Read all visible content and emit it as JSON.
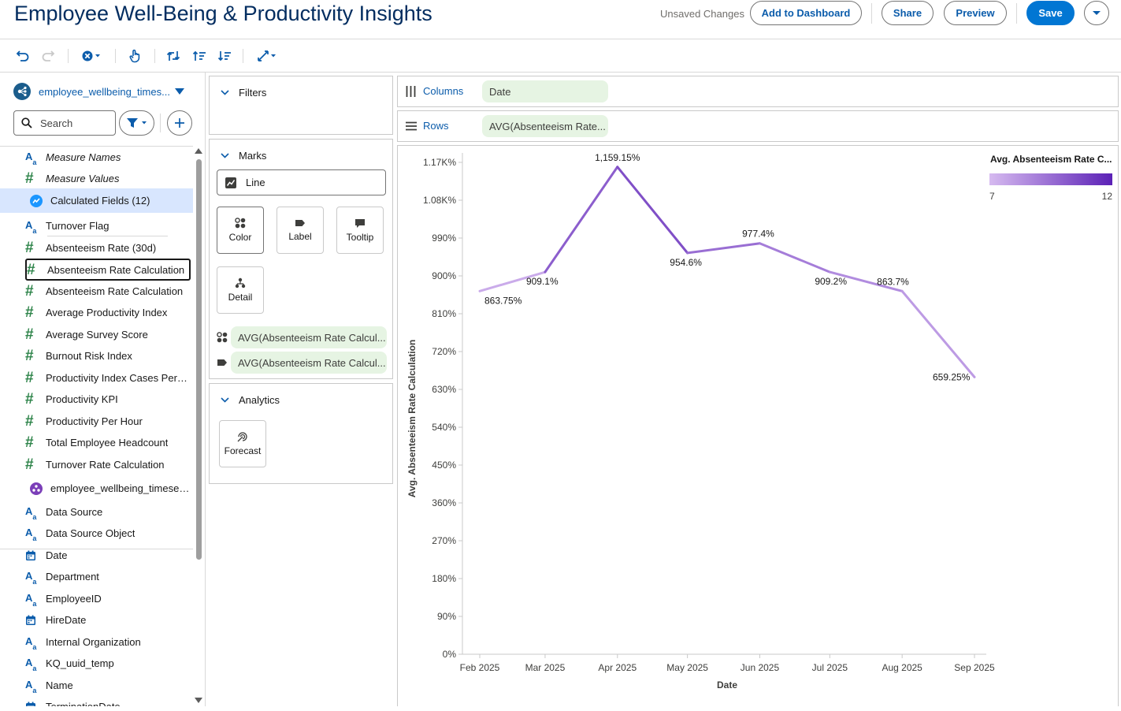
{
  "header": {
    "title": "Employee Well-Being & Productivity Insights",
    "status": "Unsaved Changes",
    "buttons": {
      "add_to_dashboard": "Add to Dashboard",
      "share": "Share",
      "preview": "Preview",
      "save": "Save"
    }
  },
  "toolbar": {
    "icons": [
      "undo-icon",
      "redo-icon",
      "clear-icon",
      "touch-icon",
      "swap-icon",
      "sort-ascending-icon",
      "sort-descending-icon",
      "fit-icon"
    ]
  },
  "data_panel": {
    "datasource": "employee_wellbeing_times...",
    "search_placeholder": "Search",
    "fields": [
      {
        "label": "Measure Names",
        "type": "text",
        "italic": true
      },
      {
        "label": "Measure Values",
        "type": "number",
        "italic": true
      },
      {
        "label": "Calculated Fields (12)",
        "type": "folder",
        "selected": true
      },
      {
        "label": "Turnover Flag",
        "type": "text"
      },
      {
        "label": "Absenteeism Rate (30d)",
        "type": "number"
      },
      {
        "label": "Absenteeism Rate Calculation",
        "type": "number",
        "outlined": true
      },
      {
        "label": "Absenteeism Rate Calculation",
        "type": "number"
      },
      {
        "label": "Average Productivity Index",
        "type": "number"
      },
      {
        "label": "Average Survey Score",
        "type": "number"
      },
      {
        "label": "Burnout Risk Index",
        "type": "number"
      },
      {
        "label": "Productivity Index Cases Per ...",
        "type": "number"
      },
      {
        "label": "Productivity KPI",
        "type": "number"
      },
      {
        "label": "Productivity Per Hour",
        "type": "number"
      },
      {
        "label": "Total Employee Headcount",
        "type": "number"
      },
      {
        "label": "Turnover Rate Calculation",
        "type": "number"
      },
      {
        "label": "employee_wellbeing_timeseri...",
        "type": "object"
      },
      {
        "label": "Data Source",
        "type": "text"
      },
      {
        "label": "Data Source Object",
        "type": "text"
      },
      {
        "label": "Date",
        "type": "date"
      },
      {
        "label": "Department",
        "type": "text"
      },
      {
        "label": "EmployeeID",
        "type": "text"
      },
      {
        "label": "HireDate",
        "type": "date"
      },
      {
        "label": "Internal Organization",
        "type": "text"
      },
      {
        "label": "KQ_uuid_temp",
        "type": "text"
      },
      {
        "label": "Name",
        "type": "text"
      },
      {
        "label": "TerminationDate",
        "type": "date"
      }
    ]
  },
  "filters": {
    "title": "Filters"
  },
  "marks": {
    "title": "Marks",
    "mark_type": "Line",
    "buttons": [
      "Color",
      "Label",
      "Tooltip",
      "Detail"
    ],
    "pills": [
      "AVG(Absenteeism Rate Calcul...",
      "AVG(Absenteeism Rate Calcul..."
    ]
  },
  "analytics": {
    "title": "Analytics",
    "buttons": [
      "Forecast"
    ]
  },
  "shelves": {
    "columns_label": "Columns",
    "columns_pill": "Date",
    "rows_label": "Rows",
    "rows_pill": "AVG(Absenteeism Rate..."
  },
  "colors": {
    "accent": "#0176d3",
    "line_light": "#d6baf0",
    "line_dark": "#5b21b6",
    "pill": "#e6f4e3"
  },
  "chart_data": {
    "type": "line",
    "xlabel": "Date",
    "ylabel": "Avg. Absenteeism Rate Calculation",
    "x": [
      "Feb 2025",
      "Mar 2025",
      "Apr 2025",
      "May 2025",
      "Jun 2025",
      "Jul 2025",
      "Aug 2025",
      "Sep 2025"
    ],
    "x_index": [
      0,
      1,
      2,
      3,
      4,
      5,
      6,
      7
    ],
    "x_dates": [
      "2025-02-01",
      "2025-03-01",
      "2025-04-01",
      "2025-05-01",
      "2025-06-01",
      "2025-07-01",
      "2025-08-01",
      "2025-09-01"
    ],
    "point_dates": [
      "2025-02-01",
      "2025-03-01",
      "2025-04-01",
      "2025-05-01",
      "2025-06-01",
      "2025-07-01",
      "2025-08-01",
      "2025-09-01"
    ],
    "values": [
      863.75,
      909.1,
      1159.15,
      954.6,
      977.4,
      909.2,
      863.7,
      659.25
    ],
    "data_labels": [
      "863.75%",
      "909.1%",
      "1,159.15%",
      "954.6%",
      "977.4%",
      "909.2%",
      "863.7%",
      "659.25%"
    ],
    "yticks": [
      0,
      90,
      180,
      270,
      360,
      450,
      540,
      630,
      720,
      810,
      900,
      990,
      1080,
      1170
    ],
    "ytick_labels": [
      "0%",
      "90%",
      "180%",
      "270%",
      "360%",
      "450%",
      "540%",
      "630%",
      "720%",
      "810%",
      "900%",
      "990%",
      "1.08K%",
      "1.17K%"
    ],
    "ylim": [
      0,
      1170
    ],
    "legend": {
      "title": "Avg. Absenteeism Rate C...",
      "min": "7",
      "max": "12",
      "position": "top-right"
    },
    "color_values": [
      7,
      8,
      12,
      9,
      10,
      8,
      9,
      7
    ]
  }
}
